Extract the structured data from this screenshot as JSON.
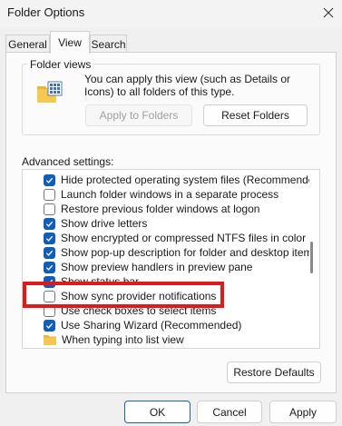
{
  "window": {
    "title": "Folder Options"
  },
  "tabs": [
    {
      "label": "General"
    },
    {
      "label": "View"
    },
    {
      "label": "Search"
    }
  ],
  "folder_views": {
    "legend": "Folder views",
    "description": "You can apply this view (such as Details or Icons) to all folders of this type.",
    "apply_button": "Apply to Folders",
    "reset_button": "Reset Folders"
  },
  "advanced": {
    "label": "Advanced settings:",
    "items": [
      {
        "label": "Hide protected operating system files (Recommended)",
        "kind": "checkbox",
        "checked": true
      },
      {
        "label": "Launch folder windows in a separate process",
        "kind": "checkbox",
        "checked": false
      },
      {
        "label": "Restore previous folder windows at logon",
        "kind": "checkbox",
        "checked": false
      },
      {
        "label": "Show drive letters",
        "kind": "checkbox",
        "checked": true
      },
      {
        "label": "Show encrypted or compressed NTFS files in color",
        "kind": "checkbox",
        "checked": true
      },
      {
        "label": "Show pop-up description for folder and desktop items",
        "kind": "checkbox",
        "checked": true
      },
      {
        "label": "Show preview handlers in preview pane",
        "kind": "checkbox",
        "checked": true
      },
      {
        "label": "Show status bar",
        "kind": "checkbox",
        "checked": true
      },
      {
        "label": "Show sync provider notifications",
        "kind": "checkbox",
        "checked": false
      },
      {
        "label": "Use check boxes to select items",
        "kind": "checkbox",
        "checked": false
      },
      {
        "label": "Use Sharing Wizard (Recommended)",
        "kind": "checkbox",
        "checked": true
      },
      {
        "label": "When typing into list view",
        "kind": "folder",
        "checked": false
      }
    ],
    "restore_button": "Restore Defaults"
  },
  "footer": {
    "ok": "OK",
    "cancel": "Cancel",
    "apply": "Apply"
  },
  "colors": {
    "checkbox_accent": "#0f5fb8",
    "highlight": "#e01a1a"
  },
  "icons": [
    "close-icon",
    "folder-view-icon",
    "checkmark-icon",
    "folder-icon"
  ]
}
